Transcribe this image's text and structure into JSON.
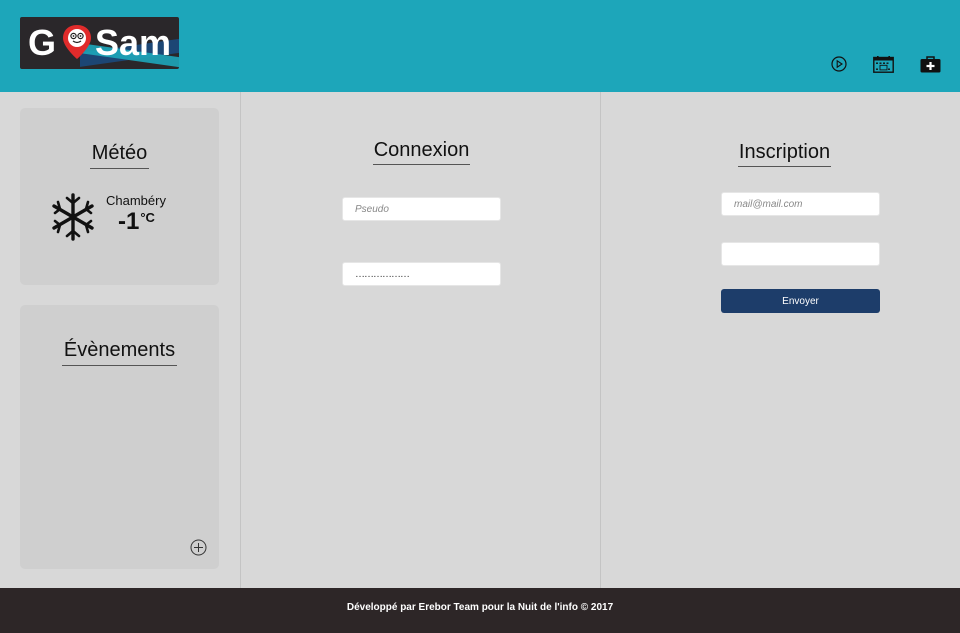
{
  "header": {
    "logo": {
      "text_left": "G",
      "text_right": "Sam",
      "brand_color": "#1da6ba"
    },
    "icons": [
      "play-circle-icon",
      "calendar-icon",
      "first-aid-kit-icon"
    ]
  },
  "meteo": {
    "title": "Météo",
    "city": "Chambéry",
    "temperature": "-1",
    "unit": "°C",
    "icon": "snowflake-icon"
  },
  "events": {
    "title": "Évènements",
    "add_icon": "plus-circle-icon"
  },
  "connexion": {
    "title": "Connexion",
    "pseudo_placeholder": "Pseudo",
    "password_value": "………………"
  },
  "inscription": {
    "title": "Inscription",
    "mail_placeholder": "mail@mail.com",
    "submit_label": "Envoyer",
    "submit_color": "#1d3d6a"
  },
  "footer": {
    "text": "Développé par Erebor Team pour la Nuit de l'info © 2017"
  }
}
